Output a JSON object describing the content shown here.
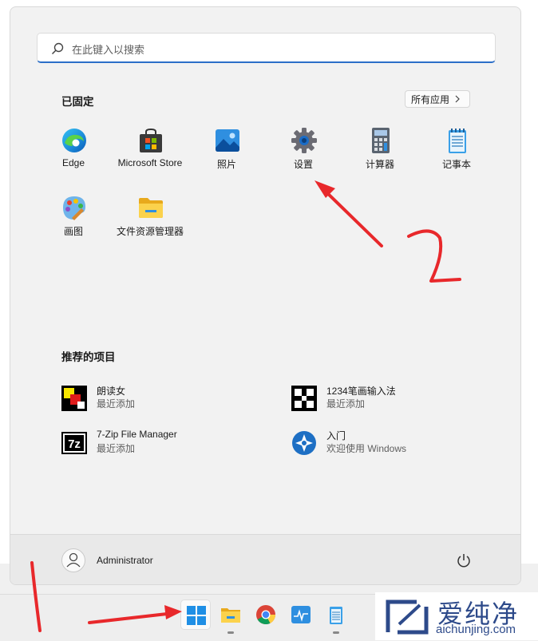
{
  "search": {
    "placeholder": "在此键入以搜索"
  },
  "pinned": {
    "title": "已固定",
    "all_apps_label": "所有应用",
    "apps": [
      {
        "label": "Edge",
        "icon": "edge-icon"
      },
      {
        "label": "Microsoft Store",
        "icon": "store-icon"
      },
      {
        "label": "照片",
        "icon": "photos-icon"
      },
      {
        "label": "设置",
        "icon": "settings-gear-icon"
      },
      {
        "label": "计算器",
        "icon": "calculator-icon"
      },
      {
        "label": "记事本",
        "icon": "notepad-icon"
      },
      {
        "label": "画图",
        "icon": "paint-icon"
      },
      {
        "label": "文件资源管理器",
        "icon": "file-explorer-icon"
      }
    ]
  },
  "recommended": {
    "title": "推荐的项目",
    "items": [
      {
        "name": "朗读女",
        "sub": "最近添加",
        "icon": "langdunv-icon"
      },
      {
        "name": "1234笔画输入法",
        "sub": "最近添加",
        "icon": "ime-1234-icon"
      },
      {
        "name": "7-Zip File Manager",
        "sub": "最近添加",
        "icon": "7zip-icon"
      },
      {
        "name": "入门",
        "sub": "欢迎使用 Windows",
        "icon": "get-started-icon"
      }
    ]
  },
  "user": {
    "name": "Administrator"
  },
  "watermark": {
    "chinese": "爱纯净",
    "url": "aichunjing.com"
  },
  "annotations": {
    "step1": "1",
    "step2": "2"
  },
  "colors": {
    "accent": "#2c6fc8",
    "annotation_red": "#e8282b",
    "menu_bg": "#f2f2f2"
  }
}
